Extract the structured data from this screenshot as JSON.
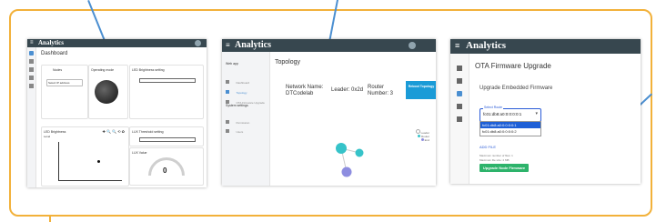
{
  "colors": {
    "frame": "#f2b13a",
    "callout": "#4b8fd1",
    "topbar": "#37474f",
    "accent": "#2aa0d8",
    "success": "#2db36b"
  },
  "panel1": {
    "brand": "Analytics",
    "user_label": "",
    "page_title": "Dashboard",
    "cards": {
      "nodes": "Nodes",
      "node_select": "Select IP address",
      "operating_mode": "Operating mode",
      "led_brightness_setting": "LED Brightness setting",
      "led_brightness": "LED Brightness",
      "led_brightness_sub": "Level",
      "lux_threshold": "LUX Threshold setting",
      "lux_value": "LUX Value",
      "gauge_value": "0",
      "chart_tools": "✚ 🔍 🔍 ⟲ ✿"
    }
  },
  "panel2": {
    "brand": "Analytics",
    "page_title": "Topology",
    "sidebar": {
      "section1": "Web app",
      "items1": [
        "Dashboard",
        "Topology",
        "OTA Firmware Upgrade"
      ],
      "section2": "System settings",
      "items2": [
        "Permission",
        "Users"
      ]
    },
    "info": {
      "network_name": "Network Name: DTCodelab",
      "leader": "Leader: 0x2d",
      "router_number": "Router Number: 3",
      "reboot_button": "Reboot Topology"
    },
    "legend": [
      "Leader",
      "Router",
      "End"
    ]
  },
  "panel3": {
    "brand": "Analytics",
    "page_title": "OTA Firmware Upgrade",
    "section_title": "Upgrade Embedded Firmware",
    "select_label": "Select Route",
    "select_value": "fc01:db8:a0:0:0:0:0:1",
    "options": [
      "fc01:db8:a0:0:0:0:0:1",
      "fc01:db8:a0:0:0:0:0:2"
    ],
    "add_file": "ADD FILE",
    "hint1": "Maximum number of files: 1",
    "hint2": "Maximum file size: 2 MB",
    "upgrade_button": "Upgrade Node Firmware"
  }
}
